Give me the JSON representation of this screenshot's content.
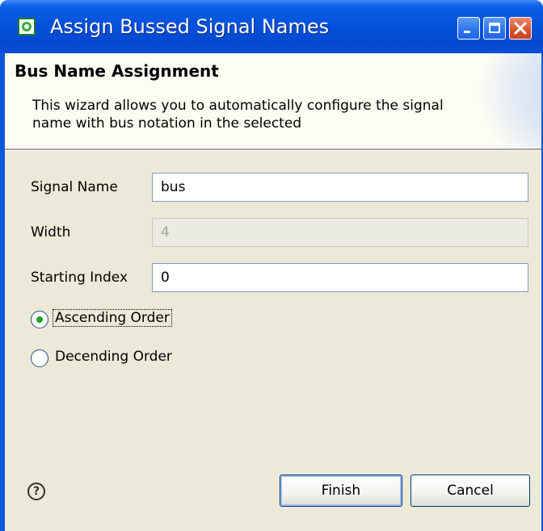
{
  "window": {
    "title": "Assign Bussed Signal Names",
    "controls": [
      "minimize-icon",
      "maximize-icon",
      "close-icon"
    ]
  },
  "banner": {
    "title": "Bus Name Assignment",
    "description": "This wizard allows you to automatically configure the signal name with bus notation in the selected"
  },
  "form": {
    "signal_name": {
      "label": "Signal Name",
      "value": "bus"
    },
    "width": {
      "label": "Width",
      "value": "4",
      "enabled": false
    },
    "starting_index": {
      "label": "Starting Index",
      "value": "0"
    },
    "order": {
      "options": [
        {
          "label": "Ascending Order",
          "selected": true
        },
        {
          "label": "Decending Order",
          "selected": false
        }
      ]
    }
  },
  "footer": {
    "help_icon": "help-icon",
    "finish_label": "Finish",
    "cancel_label": "Cancel"
  },
  "colors": {
    "titlebar": "#0552dc",
    "dialog_bg": "#ece9d8",
    "banner_bg": "#fdfdf3",
    "radio_dot": "#21a121"
  }
}
